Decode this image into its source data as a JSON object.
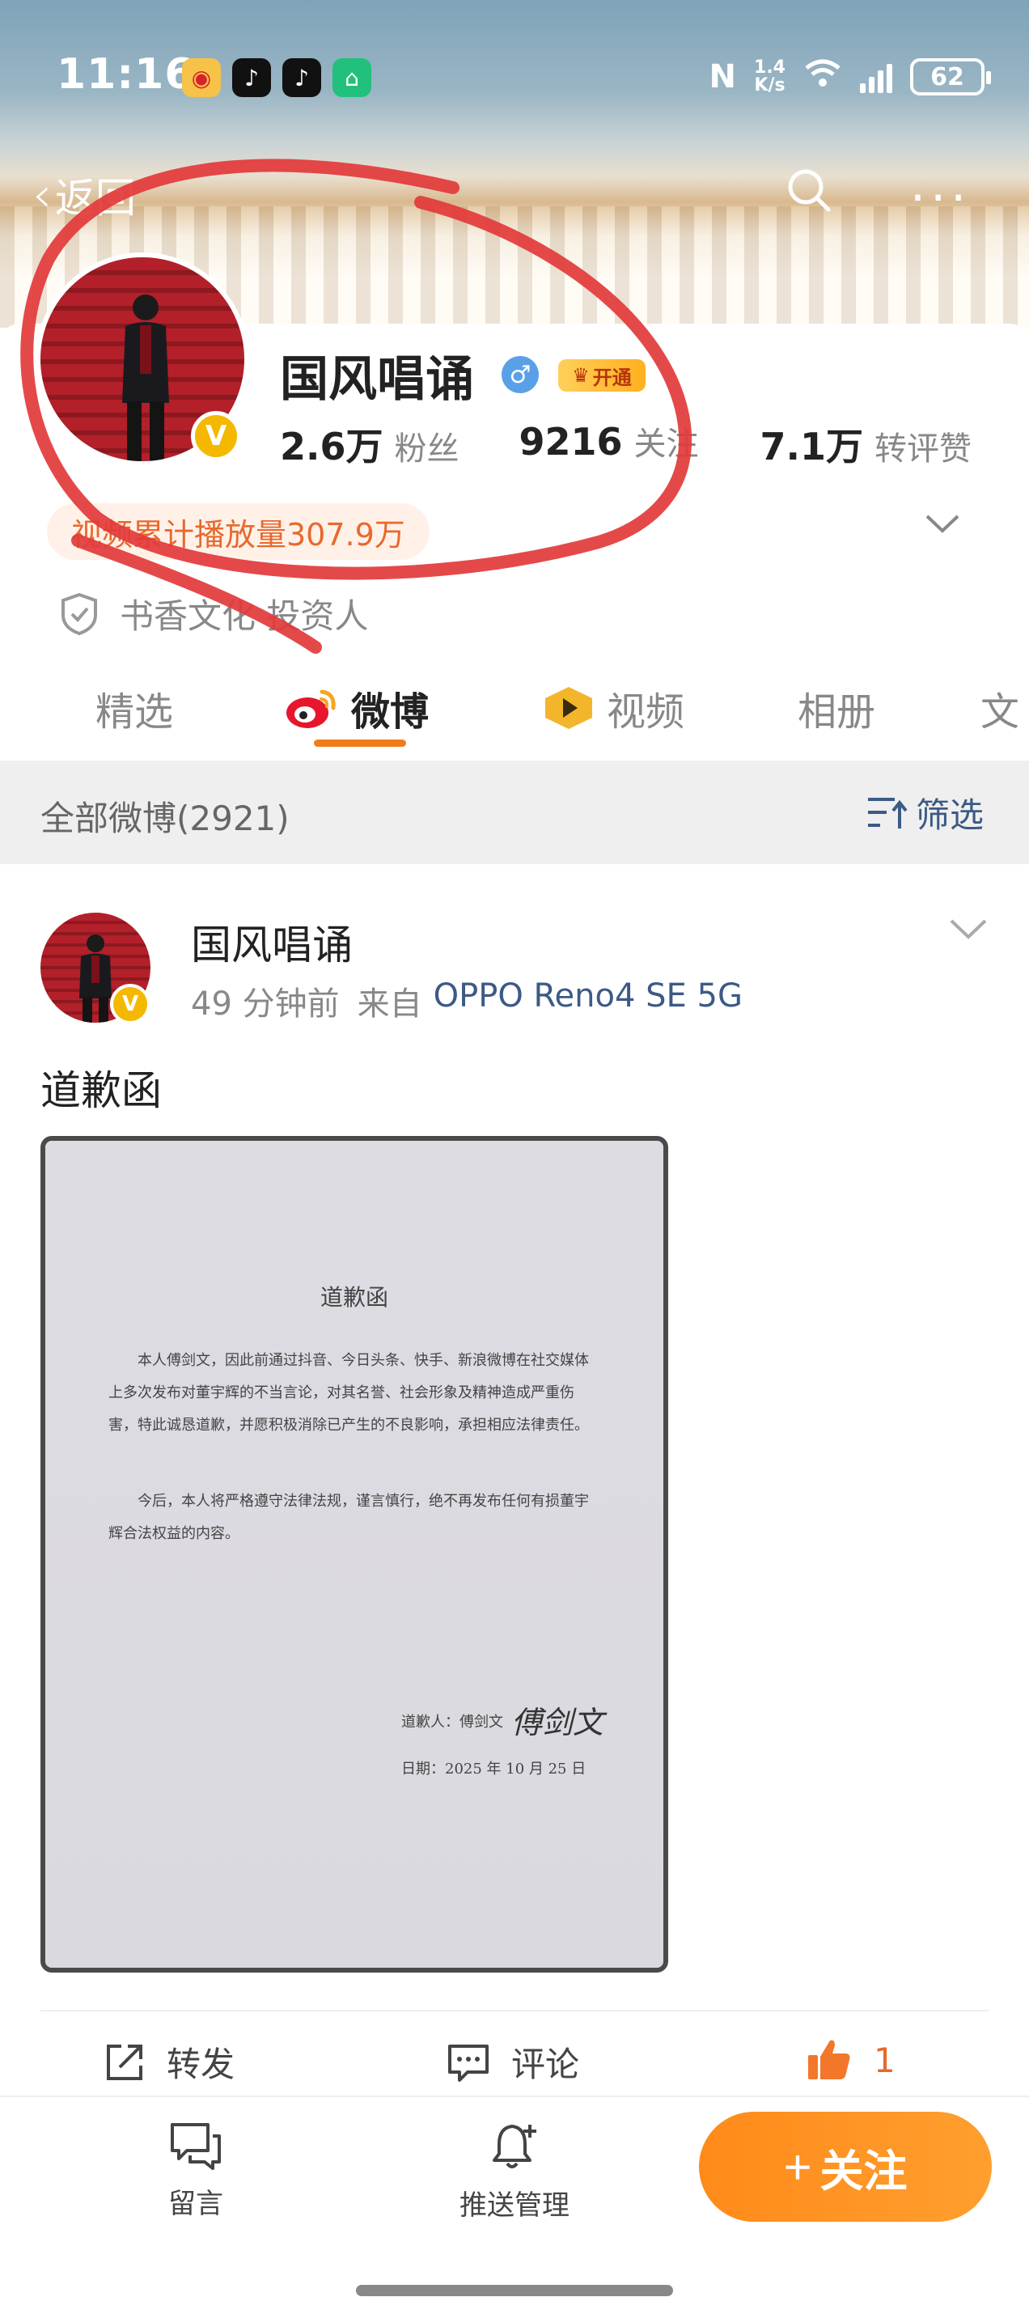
{
  "status_bar": {
    "time": "11:16",
    "network_speed_value": "1.4",
    "network_speed_unit": "K/s",
    "battery": "62"
  },
  "nav": {
    "back_label": "返回"
  },
  "profile": {
    "name": "国风唱诵",
    "vip_label": "开通",
    "stats": [
      {
        "num": "2.6万",
        "label": "粉丝"
      },
      {
        "num": "9216",
        "label": "关注"
      },
      {
        "num": "7.1万",
        "label": "转评赞"
      }
    ],
    "video_stat": "视频累计播放量307.9万",
    "investor": "书香文化 投资人"
  },
  "tabs": [
    {
      "label": "精选",
      "active": false
    },
    {
      "label": "微博",
      "active": true
    },
    {
      "label": "视频",
      "active": false
    },
    {
      "label": "相册",
      "active": false
    },
    {
      "label": "文",
      "active": false
    }
  ],
  "feed": {
    "count_label": "全部微博(2921)",
    "filter_label": "筛选"
  },
  "post": {
    "author": "国风唱诵",
    "time_ago": "49 分钟前",
    "source_prefix": "来自",
    "device": "OPPO Reno4 SE 5G",
    "text": "道歉函",
    "letter": {
      "title": "道歉函",
      "para1": "本人傅剑文，因此前通过抖音、今日头条、快手、新浪微博在社交媒体上多次发布对董宇辉的不当言论，对其名誉、社会形象及精神造成严重伤害，特此诚恳道歉，并愿积极消除已产生的不良影响，承担相应法律责任。",
      "para2": "今后，本人将严格遵守法律法规，谨言慎行，绝不再发布任何有损董宇辉合法权益的内容。",
      "sign_line": "道歉人：傅剑文",
      "signature": "傅剑文",
      "date_line": "日期：2025 年 10 月 25 日"
    },
    "actions": {
      "repost": "转发",
      "comment": "评论",
      "like_count": "1"
    }
  },
  "bottom_bar": {
    "message_label": "留言",
    "push_label": "推送管理",
    "follow_label": "关注"
  },
  "colors": {
    "accent_orange": "#f07c1a",
    "link_blue": "#3c5a86",
    "annotation_red": "#e23a3a",
    "verified_yellow": "#f5b800"
  }
}
